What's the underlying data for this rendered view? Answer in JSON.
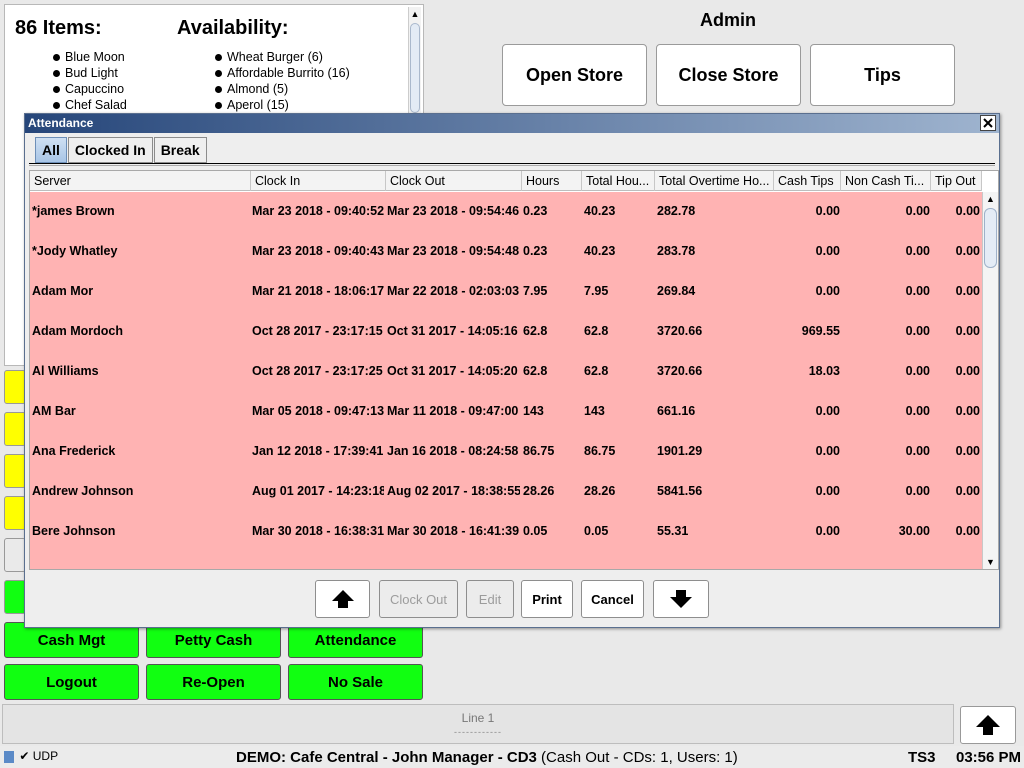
{
  "panel86": {
    "heading": "86 Items:",
    "availability_heading": "Availability:",
    "items": [
      "Blue Moon",
      "Bud Light",
      "Capuccino",
      "Chef Salad"
    ],
    "availability": [
      "Wheat Burger (6)",
      "Affordable Burrito (16)",
      "Almond (5)",
      "Aperol (15)"
    ]
  },
  "admin": {
    "title": "Admin",
    "buttons": [
      "Open Store",
      "Close Store",
      "Tips"
    ]
  },
  "bottom_buttons": [
    "Cash Mgt",
    "Petty Cash",
    "Attendance",
    "Logout",
    "Re-Open",
    "No Sale"
  ],
  "line_area": {
    "label": "Line 1",
    "dashes": "------------"
  },
  "status": {
    "udp": "UDP",
    "center": "DEMO: Cafe Central - John Manager - CD3",
    "center_detail": "(Cash Out - CDs: 1, Users: 1)",
    "terminal": "TS3",
    "time": "03:56 PM"
  },
  "dialog": {
    "title": "Attendance",
    "tabs": [
      "All",
      "Clocked In",
      "Break"
    ],
    "columns": [
      "Server",
      "Clock In",
      "Clock Out",
      "Hours",
      "Total Hou...",
      "Total Overtime Ho...",
      "Cash Tips",
      "Non Cash Ti...",
      "Tip Out"
    ],
    "rows": [
      [
        "*james Brown",
        "Mar 23 2018 - 09:40:52",
        "Mar 23 2018 - 09:54:46",
        "0.23",
        "40.23",
        "282.78",
        "0.00",
        "0.00",
        "0.00"
      ],
      [
        "*Jody Whatley",
        "Mar 23 2018 - 09:40:43",
        "Mar 23 2018 - 09:54:48",
        "0.23",
        "40.23",
        "283.78",
        "0.00",
        "0.00",
        "0.00"
      ],
      [
        "Adam  Mor",
        "Mar 21 2018 - 18:06:17",
        "Mar 22 2018 - 02:03:03",
        "7.95",
        "7.95",
        "269.84",
        "0.00",
        "0.00",
        "0.00"
      ],
      [
        "Adam  Mordoch",
        "Oct 28 2017 - 23:17:15",
        "Oct 31 2017 - 14:05:16",
        "62.8",
        "62.8",
        "3720.66",
        "969.55",
        "0.00",
        "0.00"
      ],
      [
        "Al Williams",
        "Oct 28 2017 - 23:17:25",
        "Oct 31 2017 - 14:05:20",
        "62.8",
        "62.8",
        "3720.66",
        "18.03",
        "0.00",
        "0.00"
      ],
      [
        "AM Bar",
        "Mar 05 2018 - 09:47:13",
        "Mar 11 2018 - 09:47:00",
        "143",
        "143",
        "661.16",
        "0.00",
        "0.00",
        "0.00"
      ],
      [
        "Ana Frederick",
        "Jan 12 2018 - 17:39:41",
        "Jan 16 2018 - 08:24:58",
        "86.75",
        "86.75",
        "1901.29",
        "0.00",
        "0.00",
        "0.00"
      ],
      [
        "Andrew Johnson",
        "Aug 01 2017 - 14:23:18",
        "Aug 02 2017 - 18:38:55",
        "28.26",
        "28.26",
        "5841.56",
        "0.00",
        "0.00",
        "0.00"
      ],
      [
        "Bere Johnson",
        "Mar 30 2018 - 16:38:31",
        "Mar 30 2018 - 16:41:39",
        "0.05",
        "0.05",
        "55.31",
        "0.00",
        "30.00",
        "0.00"
      ]
    ],
    "buttons": {
      "clock_out": "Clock Out",
      "edit": "Edit",
      "print": "Print",
      "cancel": "Cancel"
    }
  }
}
